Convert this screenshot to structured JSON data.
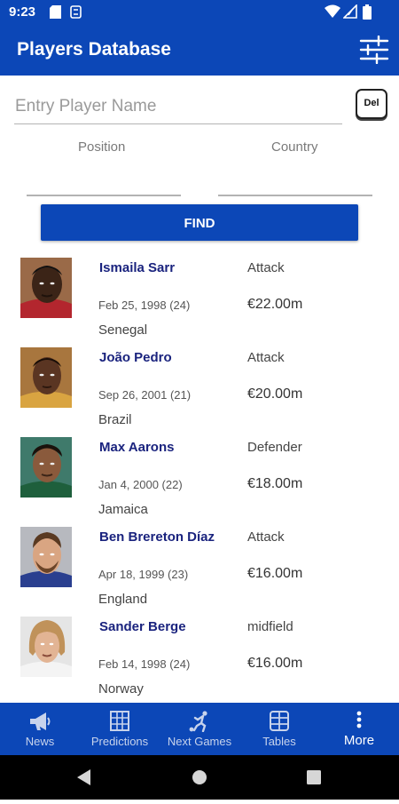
{
  "status_bar": {
    "time": "9:23"
  },
  "app_bar": {
    "title": "Players Database"
  },
  "search": {
    "name_placeholder": "Entry Player Name",
    "name_value": "",
    "del_label": "Del",
    "position_label": "Position",
    "country_label": "Country",
    "find_label": "FIND"
  },
  "players": [
    {
      "name": "Ismaila Sarr",
      "position": "Attack",
      "dob": "Feb 25, 1998 (24)",
      "value": "€22.00m",
      "country": "Senegal"
    },
    {
      "name": "João Pedro",
      "position": "Attack",
      "dob": "Sep 26, 2001 (21)",
      "value": "€20.00m",
      "country": "Brazil"
    },
    {
      "name": "Max Aarons",
      "position": "Defender",
      "dob": "Jan 4, 2000 (22)",
      "value": "€18.00m",
      "country": "Jamaica"
    },
    {
      "name": "Ben Brereton Díaz",
      "position": "Attack",
      "dob": "Apr 18, 1999 (23)",
      "value": "€16.00m",
      "country": "England"
    },
    {
      "name": "Sander Berge",
      "position": "midfield",
      "dob": "Feb 14, 1998 (24)",
      "value": "€16.00m",
      "country": "Norway"
    }
  ],
  "bottom_nav": [
    {
      "label": "News",
      "icon": "megaphone-icon"
    },
    {
      "label": "Predictions",
      "icon": "grid-icon"
    },
    {
      "label": "Next Games",
      "icon": "soccer-player-icon"
    },
    {
      "label": "Tables",
      "icon": "table-icon"
    },
    {
      "label": "More",
      "icon": "more-vertical-icon",
      "active": true
    }
  ],
  "colors": {
    "primary": "#0c47b7",
    "name_text": "#1a237e"
  }
}
